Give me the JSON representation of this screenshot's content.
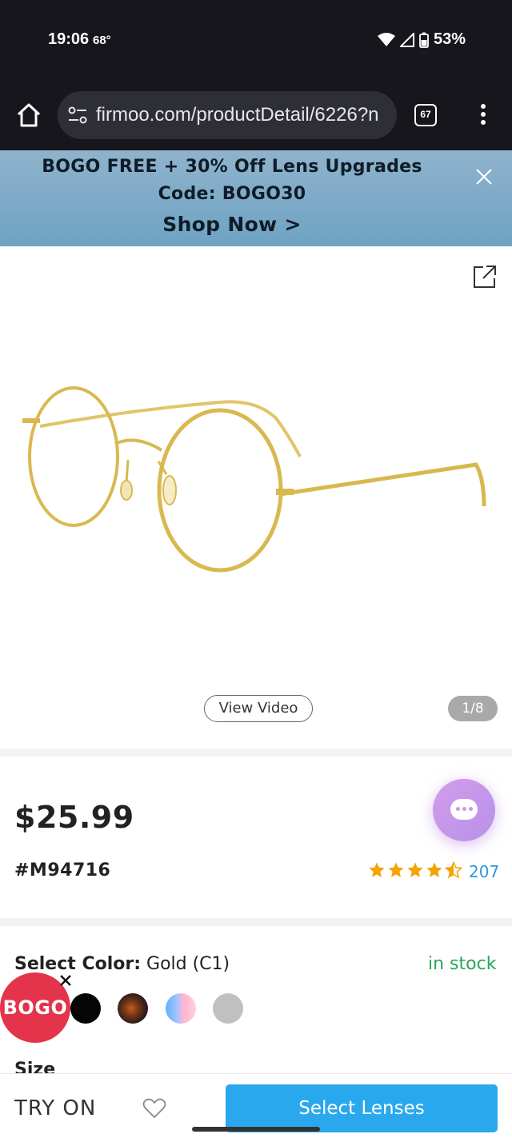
{
  "status_bar": {
    "time": "19:06",
    "temperature": "68°",
    "battery": "53%"
  },
  "browser": {
    "url": "firmoo.com/productDetail/6226?n",
    "tab_count": "67"
  },
  "promo": {
    "line1": "BOGO FREE + 30% Off Lens Upgrades",
    "line2": "Code: BOGO30",
    "cta": "Shop Now >"
  },
  "gallery": {
    "view_video_label": "View Video",
    "pager": "1/8"
  },
  "product": {
    "price": "$25.99",
    "sku": "#M94716",
    "rating": 4.5,
    "review_count": "207"
  },
  "color": {
    "label": "Select Color:",
    "selected": "Gold (C1)",
    "stock": "in stock",
    "swatches": [
      "black",
      "tortoise",
      "blue-pink",
      "grey"
    ]
  },
  "size_label": "Size",
  "bogo_badge": "BOGO",
  "bottom_bar": {
    "try_on": "TRY ON",
    "select_lenses": "Select Lenses"
  },
  "colors": {
    "accent_blue": "#2aa8ee",
    "in_stock_green": "#2aa55a",
    "bogo_red": "#e3344b",
    "star_orange": "#f5a300"
  }
}
